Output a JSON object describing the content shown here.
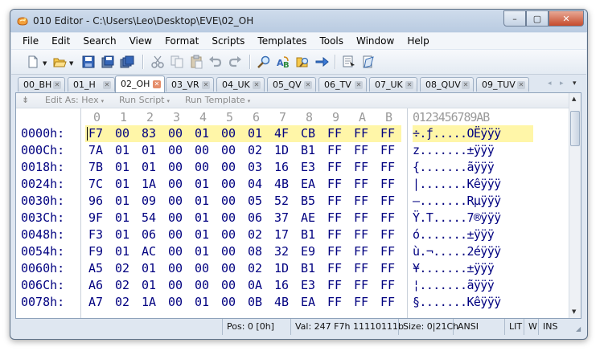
{
  "window": {
    "title": "010 Editor - C:\\Users\\Leo\\Desktop\\EVE\\02_OH",
    "controls": {
      "minimize": "–",
      "maximize": "▢",
      "close": "✕"
    }
  },
  "menu": [
    "File",
    "Edit",
    "Search",
    "View",
    "Format",
    "Scripts",
    "Templates",
    "Tools",
    "Window",
    "Help"
  ],
  "toolbar": {
    "buttons": [
      "new-file-icon",
      "open-folder-icon",
      "save-icon",
      "save-as-icon",
      "save-all-icon",
      "cut-icon",
      "copy-icon",
      "paste-icon",
      "undo-icon",
      "redo-icon",
      "find-icon",
      "replace-icon",
      "find-in-files-icon",
      "goto-icon",
      "run-icon",
      "template-icon"
    ]
  },
  "tabs": {
    "items": [
      "00_BH",
      "01_H",
      "02_OH",
      "03_VR",
      "04_UK",
      "05_QV",
      "06_TV",
      "07_UK",
      "08_QUV",
      "09_TUV"
    ],
    "active": "02_OH",
    "nav": {
      "left": "◂",
      "right": "▸",
      "menu": "▾"
    }
  },
  "editor_toolbar": {
    "edit_as": "Edit As: Hex",
    "run_script": "Run Script",
    "run_template": "Run Template",
    "dropdown": "▾",
    "handle": "⇟"
  },
  "hex_view": {
    "columns": [
      "0",
      "1",
      "2",
      "3",
      "4",
      "5",
      "6",
      "7",
      "8",
      "9",
      "A",
      "B"
    ],
    "ascii_ruler": "0123456789AB",
    "rows": [
      {
        "addr": "0000h:",
        "bytes": [
          "F7",
          "00",
          "83",
          "00",
          "01",
          "00",
          "01",
          "4F",
          "CB",
          "FF",
          "FF",
          "FF"
        ],
        "ascii": "÷.ƒ.....OËÿÿÿ"
      },
      {
        "addr": "000Ch:",
        "bytes": [
          "7A",
          "01",
          "01",
          "00",
          "00",
          "00",
          "02",
          "1D",
          "B1",
          "FF",
          "FF",
          "FF"
        ],
        "ascii": "z.......±ÿÿÿ"
      },
      {
        "addr": "0018h:",
        "bytes": [
          "7B",
          "01",
          "01",
          "00",
          "00",
          "00",
          "03",
          "16",
          "E3",
          "FF",
          "FF",
          "FF"
        ],
        "ascii": "{.......ãÿÿÿ"
      },
      {
        "addr": "0024h:",
        "bytes": [
          "7C",
          "01",
          "1A",
          "00",
          "01",
          "00",
          "04",
          "4B",
          "EA",
          "FF",
          "FF",
          "FF"
        ],
        "ascii": "|.......Kêÿÿÿ"
      },
      {
        "addr": "0030h:",
        "bytes": [
          "96",
          "01",
          "09",
          "00",
          "01",
          "00",
          "05",
          "52",
          "B5",
          "FF",
          "FF",
          "FF"
        ],
        "ascii": "–.......Rµÿÿÿ"
      },
      {
        "addr": "003Ch:",
        "bytes": [
          "9F",
          "01",
          "54",
          "00",
          "01",
          "00",
          "06",
          "37",
          "AE",
          "FF",
          "FF",
          "FF"
        ],
        "ascii": "Ÿ.T.....7®ÿÿÿ"
      },
      {
        "addr": "0048h:",
        "bytes": [
          "F3",
          "01",
          "06",
          "00",
          "01",
          "00",
          "02",
          "17",
          "B1",
          "FF",
          "FF",
          "FF"
        ],
        "ascii": "ó.......±ÿÿÿ"
      },
      {
        "addr": "0054h:",
        "bytes": [
          "F9",
          "01",
          "AC",
          "00",
          "01",
          "00",
          "08",
          "32",
          "E9",
          "FF",
          "FF",
          "FF"
        ],
        "ascii": "ù.¬.....2éÿÿÿ"
      },
      {
        "addr": "0060h:",
        "bytes": [
          "A5",
          "02",
          "01",
          "00",
          "00",
          "00",
          "02",
          "1D",
          "B1",
          "FF",
          "FF",
          "FF"
        ],
        "ascii": "¥.......±ÿÿÿ"
      },
      {
        "addr": "006Ch:",
        "bytes": [
          "A6",
          "02",
          "01",
          "00",
          "00",
          "00",
          "0A",
          "16",
          "E3",
          "FF",
          "FF",
          "FF"
        ],
        "ascii": "¦.......ãÿÿÿ"
      },
      {
        "addr": "0078h:",
        "bytes": [
          "A7",
          "02",
          "1A",
          "00",
          "01",
          "00",
          "0B",
          "4B",
          "EA",
          "FF",
          "FF",
          "FF"
        ],
        "ascii": "§.......Kêÿÿÿ"
      }
    ]
  },
  "status": {
    "pos": "Pos: 0 [0h]",
    "val": "Val: 247 F7h 11110111b",
    "size": "Size: 0|21Ch",
    "encoding": "ANSI",
    "endian": "LIT",
    "mode": "W",
    "insert": "INS"
  },
  "colors": {
    "hex_text": "#000080",
    "highlight": "#fff6a8",
    "window_frame": "#dfe7f1"
  }
}
